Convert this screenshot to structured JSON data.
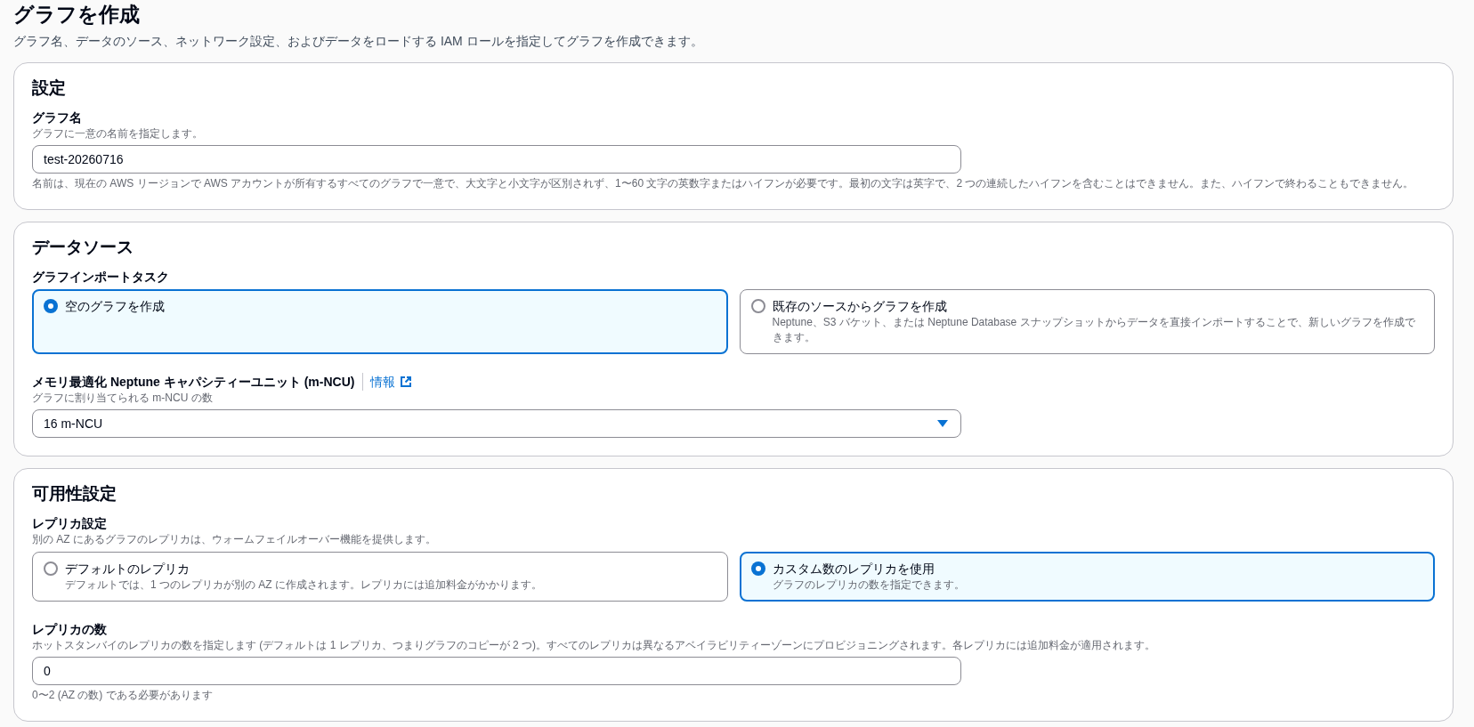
{
  "page": {
    "title": "グラフを作成",
    "description": "グラフ名、データのソース、ネットワーク設定、およびデータをロードする IAM ロールを指定してグラフを作成できます。"
  },
  "sections": [
    {
      "heading": "設定",
      "fields": [
        {
          "kind": "text_input",
          "label": "グラフ名",
          "description": "グラフに一意の名前を指定します。",
          "value": "test-20260716",
          "constraint": "名前は、現在の AWS リージョンで AWS アカウントが所有するすべてのグラフで一意で、大文字と小文字が区別されず、1〜60 文字の英数字またはハイフンが必要です。最初の文字は英字で、2 つの連続したハイフンを含むことはできません。また、ハイフンで終わることもできません。"
        }
      ]
    },
    {
      "heading": "データソース",
      "fields": [
        {
          "kind": "radio_tiles",
          "label": "グラフインポートタスク",
          "options": [
            {
              "label": "空のグラフを作成",
              "selected": true
            },
            {
              "label": "既存のソースからグラフを作成",
              "description": "Neptune、S3 バケット、または Neptune Database スナップショットからデータを直接インポートすることで、新しいグラフを作成できます。",
              "selected": false
            }
          ]
        },
        {
          "kind": "select",
          "label": "メモリ最適化 Neptune キャパシティーユニット (m-NCU)",
          "info_link": "情報",
          "description": "グラフに割り当てられる m-NCU の数",
          "value": "16 m-NCU"
        }
      ]
    },
    {
      "heading": "可用性設定",
      "fields": [
        {
          "kind": "radio_tiles",
          "label": "レプリカ設定",
          "description": "別の AZ にあるグラフのレプリカは、ウォームフェイルオーバー機能を提供します。",
          "options": [
            {
              "label": "デフォルトのレプリカ",
              "description": "デフォルトでは、1 つのレプリカが別の AZ に作成されます。レプリカには追加料金がかかります。",
              "selected": false
            },
            {
              "label": "カスタム数のレプリカを使用",
              "description": "グラフのレプリカの数を指定できます。",
              "selected": true
            }
          ]
        },
        {
          "kind": "text_input",
          "label": "レプリカの数",
          "description": "ホットスタンバイのレプリカの数を指定します (デフォルトは 1 レプリカ、つまりグラフのコピーが 2 つ)。すべてのレプリカは異なるアベイラビリティーゾーンにプロビジョニングされます。各レプリカには追加料金が適用されます。",
          "value": "0",
          "constraint": "0〜2 (AZ の数) である必要があります"
        }
      ]
    }
  ]
}
